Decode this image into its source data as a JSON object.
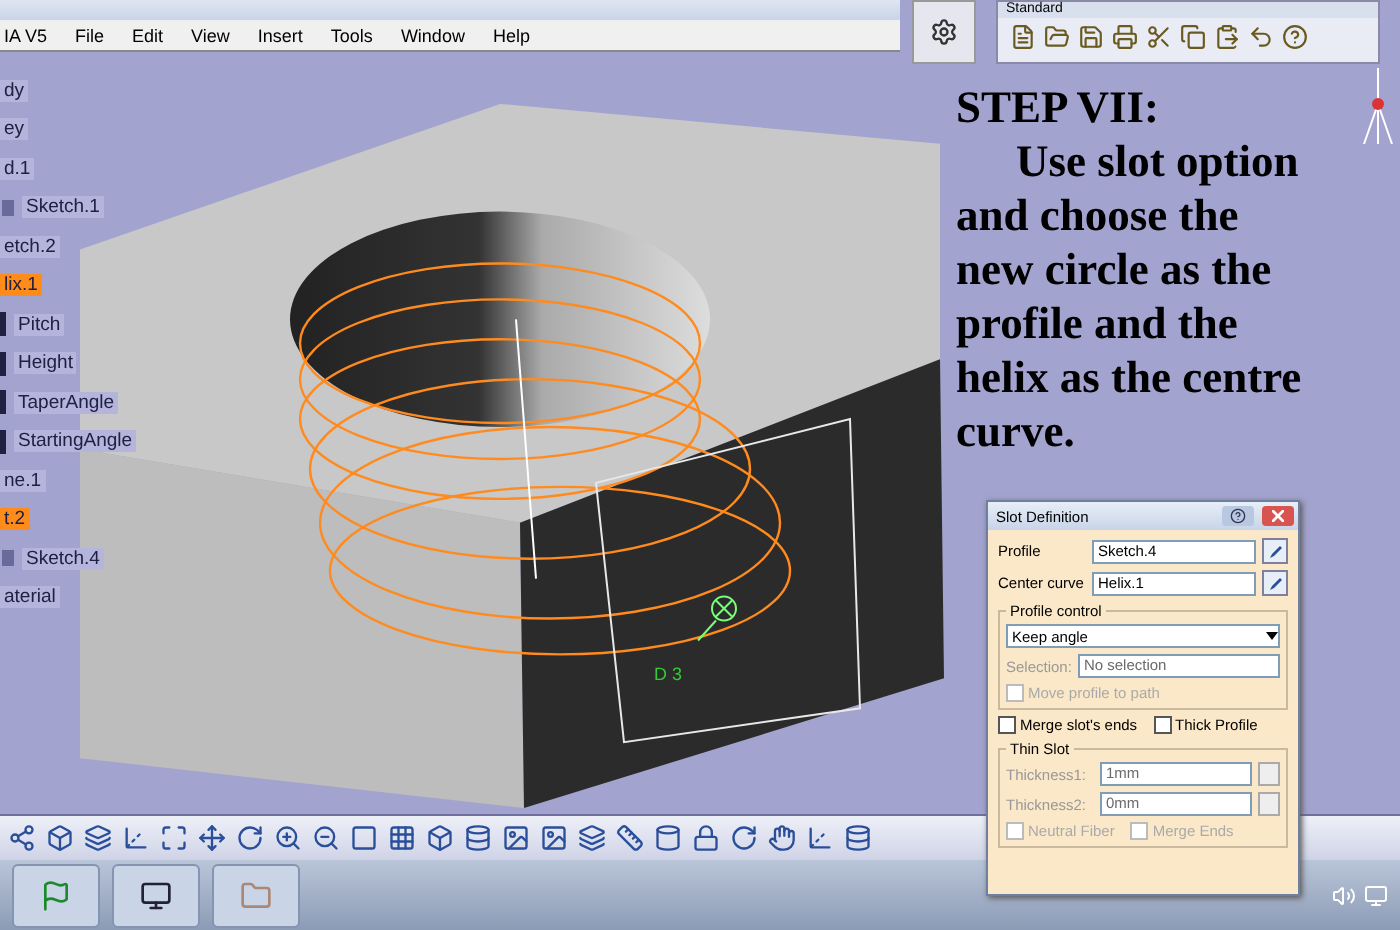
{
  "menu_bar": {
    "app_label": "IA V5",
    "items": [
      "File",
      "Edit",
      "View",
      "Insert",
      "Tools",
      "Window",
      "Help"
    ]
  },
  "standard_toolbar": {
    "title": "Standard"
  },
  "tree": {
    "items": [
      {
        "label": "dy",
        "kind": "plain",
        "selected": false
      },
      {
        "label": "ey",
        "kind": "plain",
        "selected": false
      },
      {
        "label": "d.1",
        "kind": "plain",
        "selected": false
      },
      {
        "label": "Sketch.1",
        "kind": "sketch",
        "selected": false
      },
      {
        "label": "etch.2",
        "kind": "plain",
        "selected": false
      },
      {
        "label": "lix.1",
        "kind": "plain",
        "selected": true
      },
      {
        "label": "Pitch",
        "kind": "parameter",
        "selected": false
      },
      {
        "label": "Height",
        "kind": "parameter",
        "selected": false
      },
      {
        "label": "TaperAngle",
        "kind": "parameter",
        "selected": false
      },
      {
        "label": "StartingAngle",
        "kind": "parameter",
        "selected": false
      },
      {
        "label": "ne.1",
        "kind": "plain",
        "selected": false
      },
      {
        "label": "t.2",
        "kind": "plain",
        "selected": true
      },
      {
        "label": "Sketch.4",
        "kind": "sketch",
        "selected": false
      },
      {
        "label": "aterial",
        "kind": "plain",
        "selected": false
      }
    ]
  },
  "instructions": {
    "heading": "STEP VII:",
    "body_lines": [
      "Use slot option",
      "and choose the",
      "new circle as the",
      "profile and the",
      "helix as the centre",
      "curve."
    ]
  },
  "viewport": {
    "point_label": "D 3"
  },
  "slot_dialog": {
    "title": "Slot Definition",
    "profile": {
      "label": "Profile",
      "value": "Sketch.4"
    },
    "center_curve": {
      "label": "Center curve",
      "value": "Helix.1"
    },
    "profile_control": {
      "title": "Profile control",
      "option": "Keep angle",
      "selection_label": "Selection:",
      "selection_value": "No selection",
      "move_profile": {
        "label": "Move profile to path",
        "checked": false,
        "disabled": true
      }
    },
    "options": [
      {
        "label": "Merge slot's ends",
        "checked": false,
        "disabled": false
      },
      {
        "label": "Thick Profile",
        "checked": false,
        "disabled": false
      }
    ],
    "thin_slot": {
      "title": "Thin Slot",
      "fields": [
        {
          "label": "Thickness1:",
          "value": "1mm",
          "disabled": true
        },
        {
          "label": "Thickness2:",
          "value": "0mm",
          "disabled": true
        }
      ],
      "options": [
        {
          "label": "Neutral Fiber",
          "checked": false,
          "disabled": true
        },
        {
          "label": "Merge Ends",
          "checked": false,
          "disabled": true
        }
      ]
    }
  }
}
